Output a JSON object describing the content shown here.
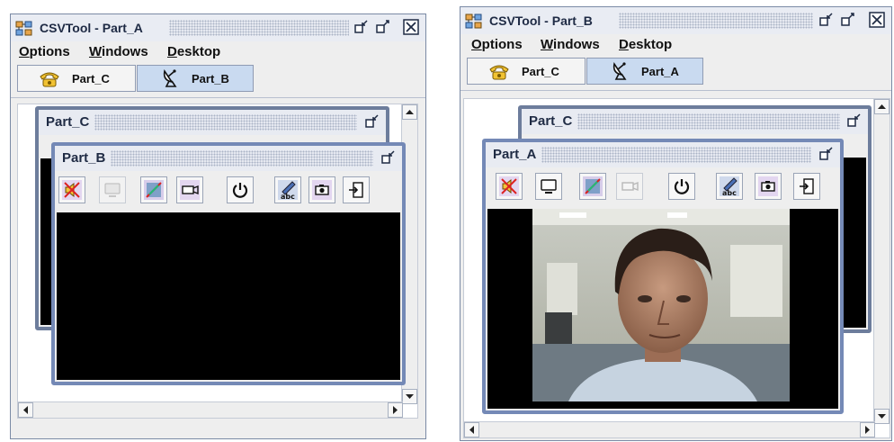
{
  "windows": [
    {
      "title": "CSVTool - Part_A",
      "menus": {
        "options": "ptions",
        "options_mnemonic": "O",
        "windows": "indows",
        "windows_mnemonic": "W",
        "desktop": "esktop",
        "desktop_mnemonic": "D"
      },
      "tabs": [
        {
          "label": "Part_C",
          "icon": "telephone-icon"
        },
        {
          "label": "Part_B",
          "icon": "satellite-dish-icon"
        }
      ],
      "active_tab": "Part_B",
      "frames": {
        "back": "Part_C",
        "front": "Part_B"
      },
      "video": "black"
    },
    {
      "title": "CSVTool - Part_B",
      "menus": {
        "options": "ptions",
        "options_mnemonic": "O",
        "windows": "indows",
        "windows_mnemonic": "W",
        "desktop": "esktop",
        "desktop_mnemonic": "D"
      },
      "tabs": [
        {
          "label": "Part_C",
          "icon": "telephone-icon"
        },
        {
          "label": "Part_A",
          "icon": "satellite-dish-icon"
        }
      ],
      "active_tab": "Part_A",
      "frames": {
        "back": "Part_C",
        "front": "Part_A"
      },
      "video": "webcam feed of participant"
    }
  ],
  "toolbar_icons": [
    "mute-speaker-icon",
    "monitor-icon",
    "video-off-icon",
    "camera-icon",
    "power-icon",
    "text-edit-icon",
    "snapshot-icon",
    "exit-icon"
  ],
  "colors": {
    "frame_border": "#7489b6",
    "active_tab": "#c9daf0",
    "video_bg": "#000000"
  }
}
